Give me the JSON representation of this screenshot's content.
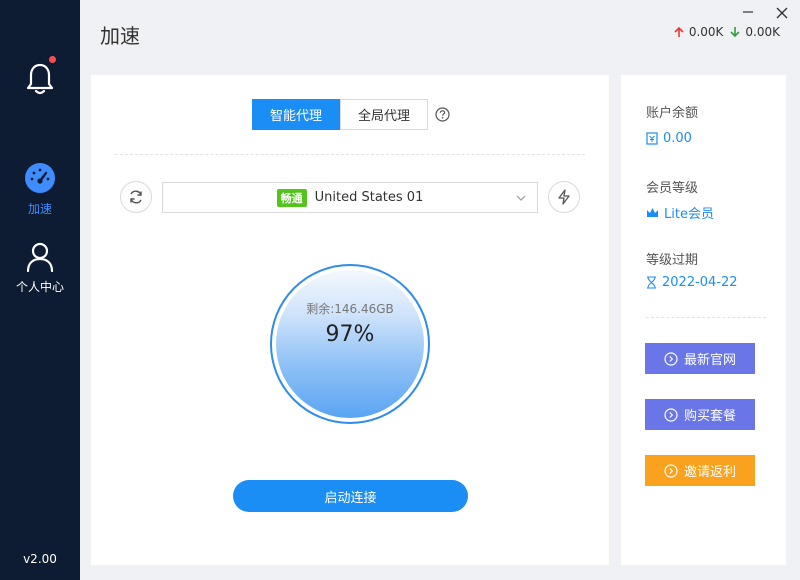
{
  "sidebar": {
    "nav": [
      {
        "label": "加速",
        "icon": "speedometer-icon",
        "active": true
      },
      {
        "label": "个人中心",
        "icon": "user-icon",
        "active": false
      }
    ],
    "version": "v2.00",
    "accent": "#3f8cff"
  },
  "header": {
    "title": "加速",
    "upload": "0.00K",
    "download": "0.00K"
  },
  "main": {
    "mode_tabs": [
      "智能代理",
      "全局代理"
    ],
    "active_mode": "智能代理",
    "server": {
      "badge": "畅通",
      "name": "United States 01"
    },
    "gauge": {
      "remaining": "剩余:146.46GB",
      "percent": "97%"
    },
    "connect_label": "启动连接"
  },
  "account": {
    "balance_label": "账户余额",
    "balance": "0.00",
    "level_label": "会员等级",
    "level": "Lite会员",
    "expiry_label": "等级过期",
    "expiry": "2022-04-22"
  },
  "actions": [
    {
      "label": "最新官网",
      "color": "#6a76e8"
    },
    {
      "label": "购买套餐",
      "color": "#6a76e8"
    },
    {
      "label": "邀请返利",
      "color": "#faa21d"
    }
  ]
}
